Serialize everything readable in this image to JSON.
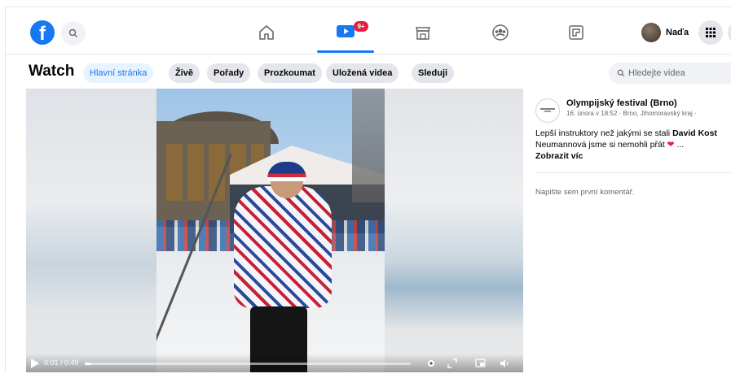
{
  "nav": {
    "logo": "f",
    "notification_badge": "9+",
    "profile_name": "Naďa"
  },
  "watch": {
    "title": "Watch",
    "tabs": [
      {
        "label": "Hlavní stránka",
        "active": true
      },
      {
        "label": "Živě",
        "active": false
      },
      {
        "label": "Pořady",
        "active": false
      },
      {
        "label": "Prozkoumat",
        "active": false
      },
      {
        "label": "Uložená videa",
        "active": false
      },
      {
        "label": "Sleduji",
        "active": false
      }
    ],
    "search_placeholder": "Hledejte videa"
  },
  "video": {
    "time": "0:01 / 0:49",
    "progress": 0.02
  },
  "post": {
    "page_name": "Olympijský festival (Brno)",
    "meta": "16. února v 18:52 · Brno, Jihomoravský kraj ·",
    "text_start": "Lepší instruktory než jakými se stali ",
    "text_bold": "David Kost",
    "text_rest": "Neumannová jsme si nemohli přát",
    "text_end": " ...",
    "see_more": "Zobrazit víc",
    "comment_placeholder": "Napište sem první komentář."
  },
  "colors": {
    "brand": "#1877f2",
    "badge": "#e41e3f",
    "pill": "#e4e6eb",
    "active_pill": "#e7f3ff"
  }
}
